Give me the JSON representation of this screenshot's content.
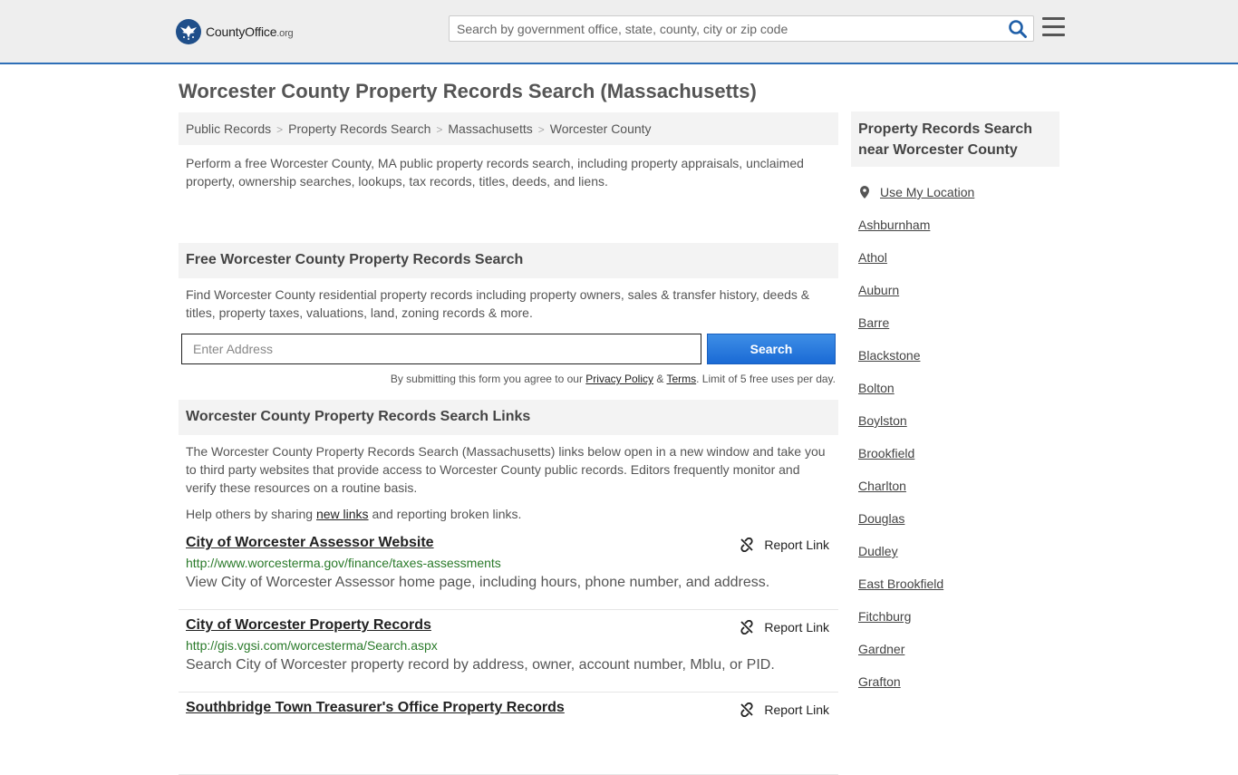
{
  "header": {
    "logo_county": "County",
    "logo_office": "Office",
    "logo_org": ".org",
    "search_placeholder": "Search by government office, state, county, city or zip code"
  },
  "page": {
    "title": "Worcester County Property Records Search (Massachusetts)"
  },
  "breadcrumb": [
    "Public Records",
    "Property Records Search",
    "Massachusetts",
    "Worcester County"
  ],
  "intro": "Perform a free Worcester County, MA public property records search, including property appraisals, unclaimed property, ownership searches, lookups, tax records, titles, deeds, and liens.",
  "free_search": {
    "heading": "Free Worcester County Property Records Search",
    "text": "Find Worcester County residential property records including property owners, sales & transfer history, deeds & titles, property taxes, valuations, land, zoning records & more.",
    "address_placeholder": "Enter Address",
    "button": "Search",
    "disclaimer_pre": "By submitting this form you agree to our",
    "privacy": "Privacy Policy",
    "amp": "&",
    "terms": "Terms",
    "disclaimer_post": ". Limit of 5 free uses per day."
  },
  "links_section": {
    "heading": "Worcester County Property Records Search Links",
    "text": "The Worcester County Property Records Search (Massachusetts) links below open in a new window and take you to third party websites that provide access to Worcester County public records. Editors frequently monitor and verify these resources on a routine basis.",
    "share_pre": "Help others by sharing",
    "share_link": "new links",
    "share_post": "and reporting broken links.",
    "report_label": "Report Link",
    "items": [
      {
        "title": "City of Worcester Assessor Website",
        "url": "http://www.worcesterma.gov/finance/taxes-assessments",
        "desc": "View City of Worcester Assessor home page, including hours, phone number, and address."
      },
      {
        "title": "City of Worcester Property Records",
        "url": "http://gis.vgsi.com/worcesterma/Search.aspx",
        "desc": "Search City of Worcester property record by address, owner, account number, Mblu, or PID."
      },
      {
        "title": "Southbridge Town Treasurer's Office Property Records",
        "url": "",
        "desc": ""
      }
    ]
  },
  "sidebar": {
    "heading": "Property Records Search near Worcester County",
    "use_location": "Use My Location",
    "towns": [
      "Ashburnham",
      "Athol",
      "Auburn",
      "Barre",
      "Blackstone",
      "Bolton",
      "Boylston",
      "Brookfield",
      "Charlton",
      "Douglas",
      "Dudley",
      "East Brookfield",
      "Fitchburg",
      "Gardner",
      "Grafton"
    ]
  },
  "colors": {
    "accent_blue": "#2e6fb7",
    "button_blue": "#1a6ad5",
    "url_green": "#2a7a2a"
  }
}
